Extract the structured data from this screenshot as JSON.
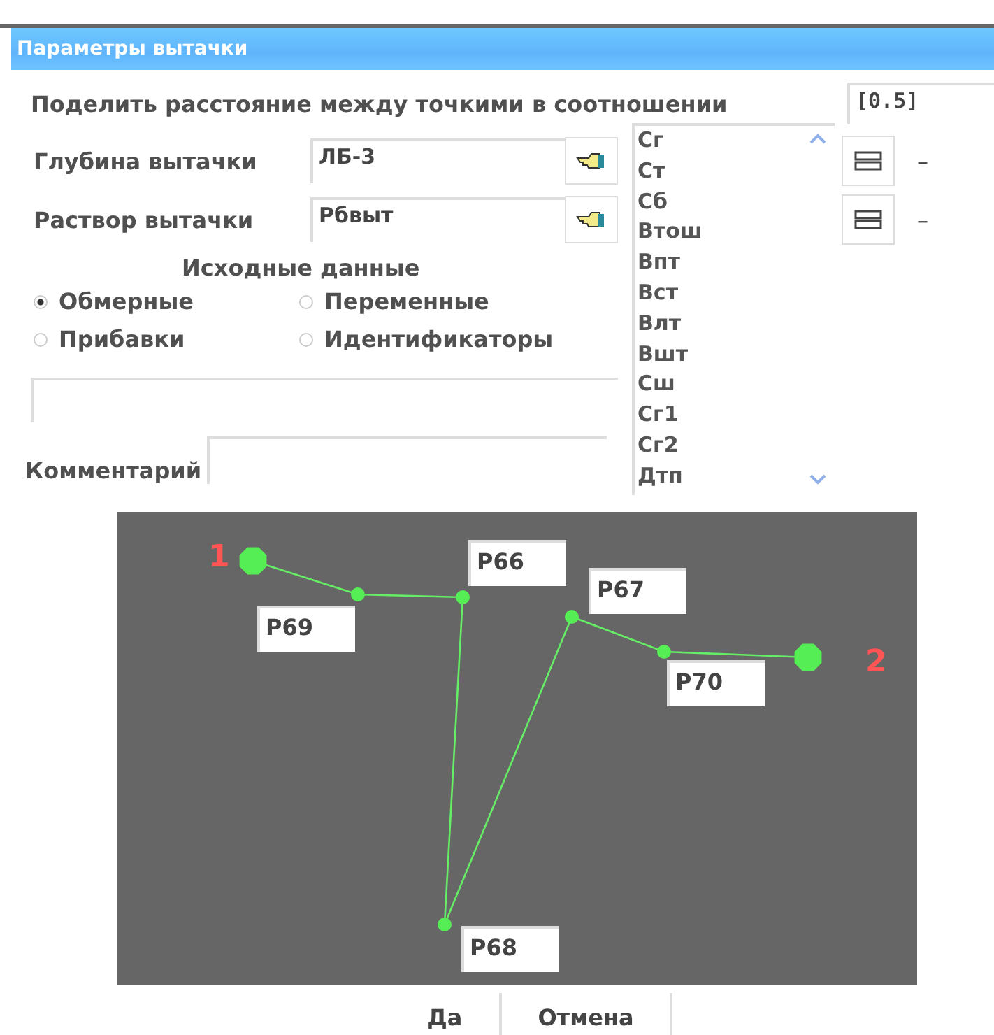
{
  "window": {
    "title": "Параметры вытачки"
  },
  "ratio": {
    "label": "Поделить расстояние  между точкими в соотношении",
    "value": "[0.5]"
  },
  "depth": {
    "label": "Глубина вытачки",
    "value": "ЛБ-3"
  },
  "opening": {
    "label": "Раствор вытачки",
    "value": "Рбвыт"
  },
  "source": {
    "title": "Исходные данные",
    "options": [
      {
        "label": "Обмерные",
        "selected": true
      },
      {
        "label": "Переменные",
        "selected": false
      },
      {
        "label": "Прибавки",
        "selected": false
      },
      {
        "label": "Идентификаторы",
        "selected": false
      }
    ]
  },
  "variables": [
    "Сг",
    "Ст",
    "Сб",
    "Втош",
    "Впт",
    "Вст",
    "Влт",
    "Вшт",
    "Сш",
    "Сг1",
    "Сг2",
    "Дтп"
  ],
  "side_marks": [
    "–",
    "–"
  ],
  "comment": {
    "label": "Комментарий"
  },
  "diagram": {
    "points": [
      {
        "kind": "endpoint",
        "label": "1"
      },
      {
        "kind": "point",
        "label": "Р69"
      },
      {
        "kind": "point",
        "label": "Р66"
      },
      {
        "kind": "point",
        "label": "Р68"
      },
      {
        "kind": "point",
        "label": "Р67"
      },
      {
        "kind": "point",
        "label": "Р70"
      },
      {
        "kind": "endpoint",
        "label": "2"
      }
    ]
  },
  "buttons": [
    "Да",
    "Отмена"
  ]
}
